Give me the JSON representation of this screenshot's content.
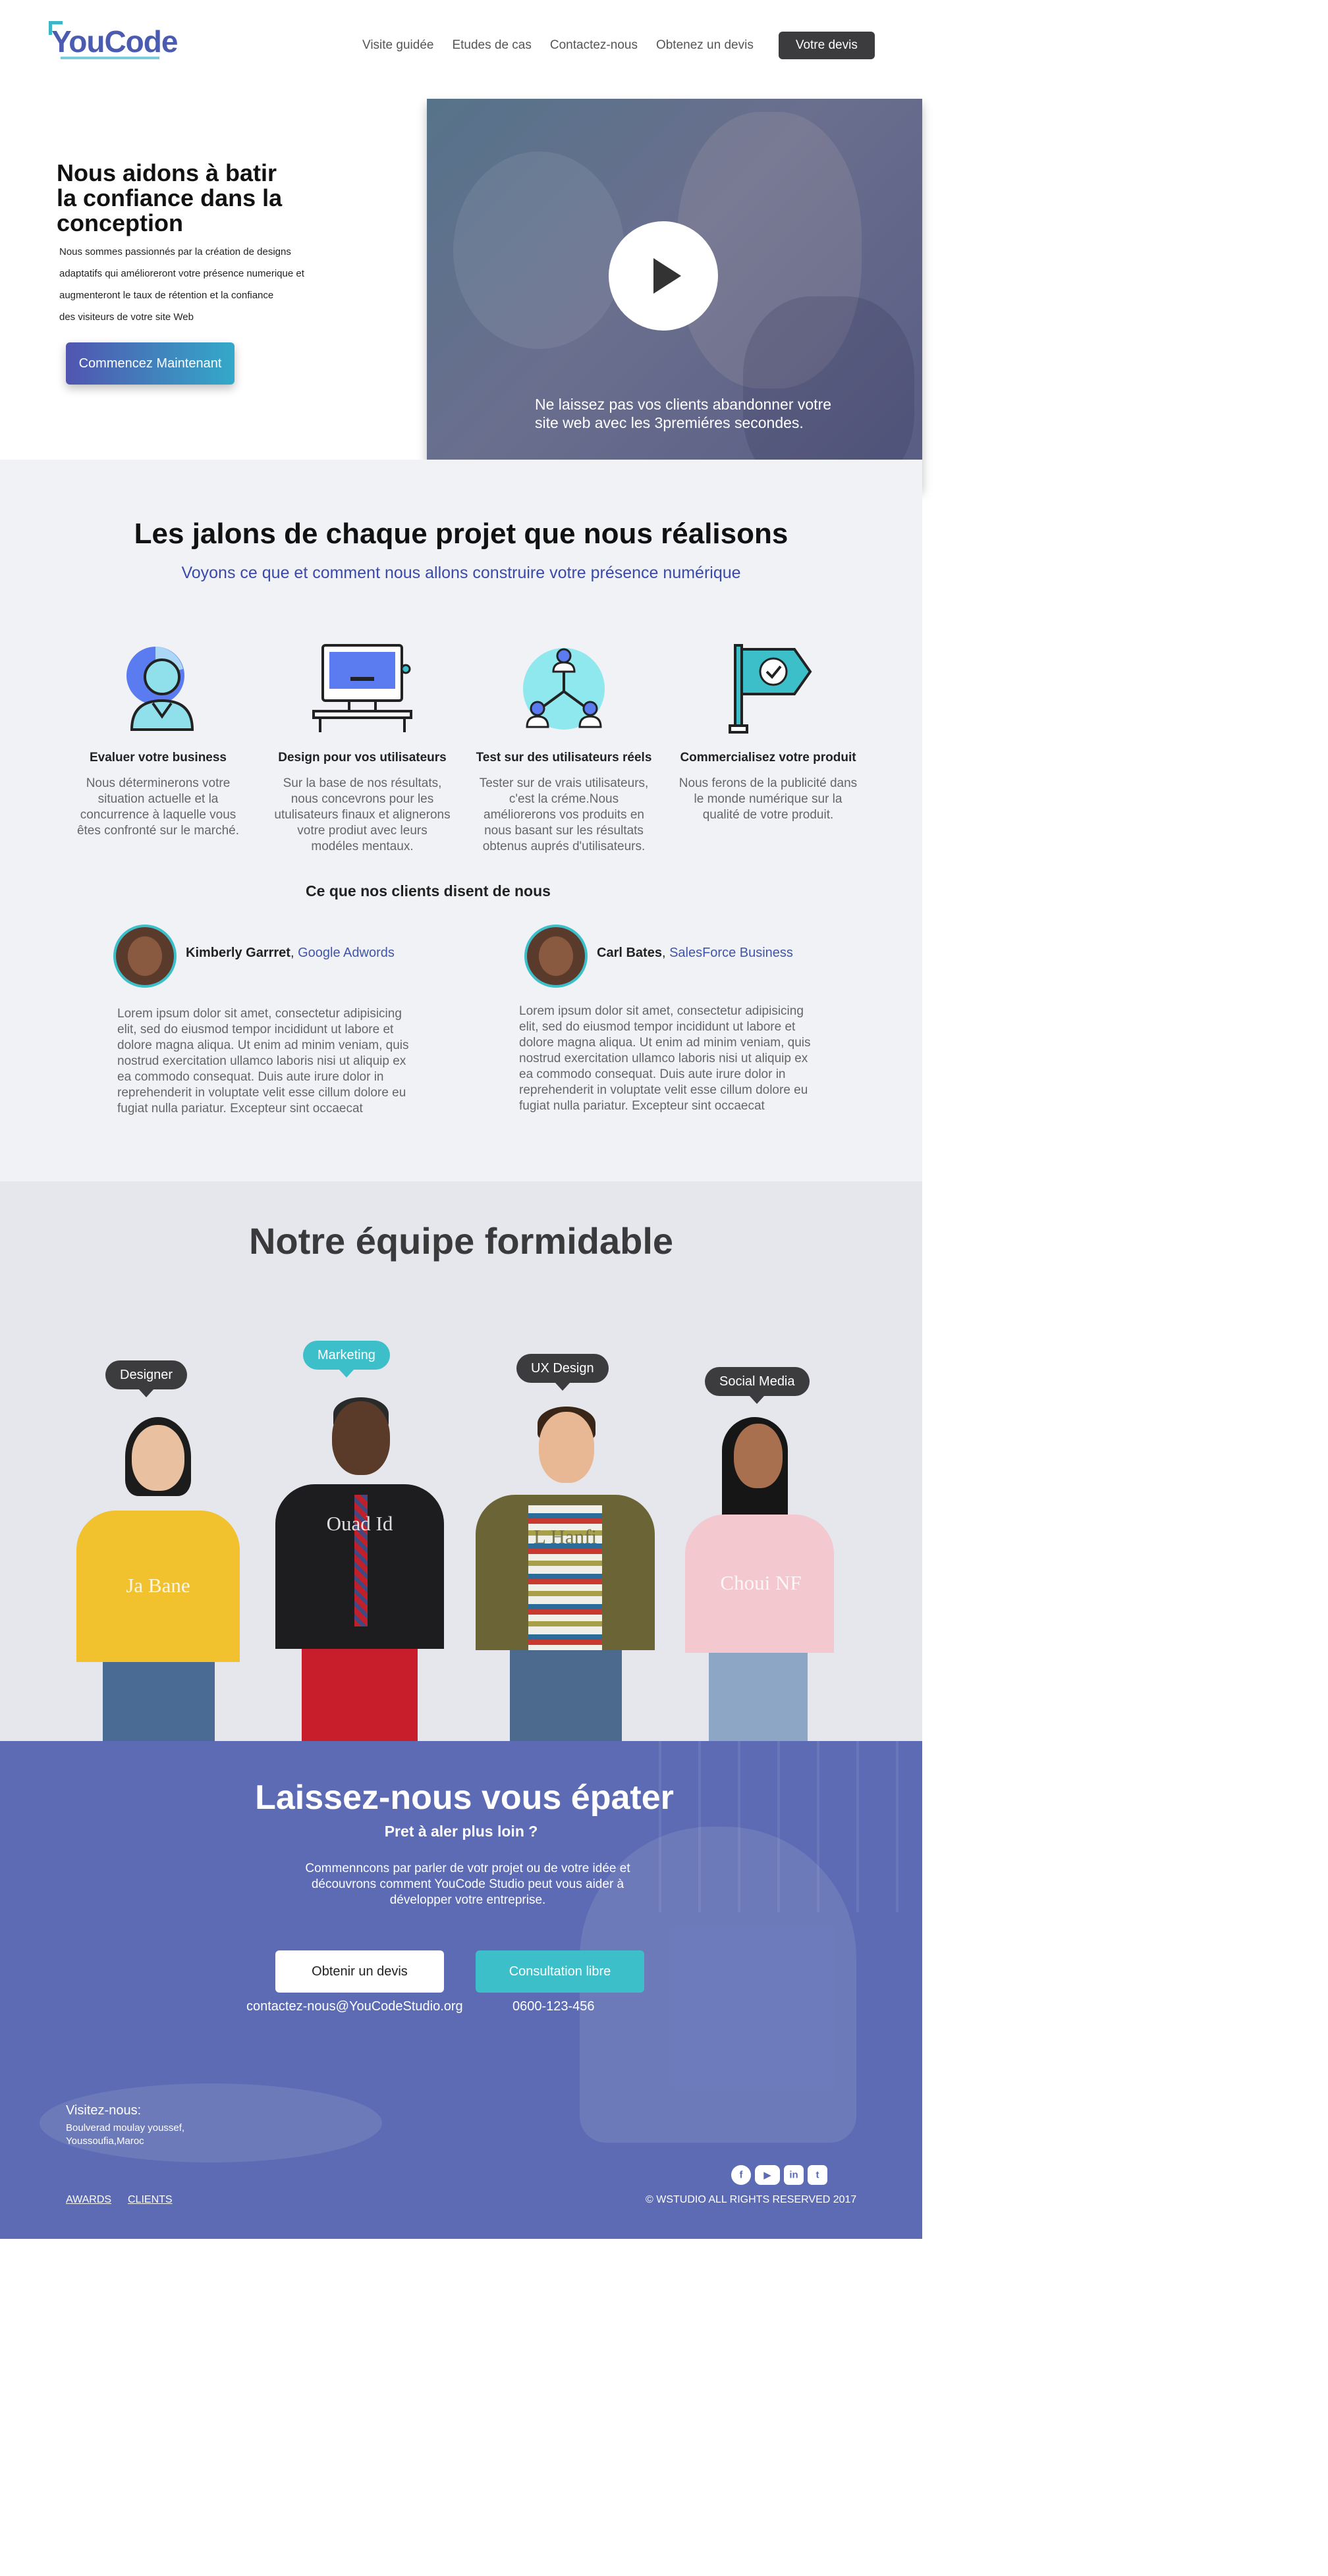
{
  "header": {
    "logo": "YouCode",
    "nav": [
      "Visite guidée",
      "Etudes de cas",
      "Contactez-nous",
      "Obtenez un devis"
    ],
    "cta": "Votre devis"
  },
  "hero": {
    "title_lines": [
      "Nous aidons à batir",
      "la confiance dans la",
      "conception"
    ],
    "desc_lines": [
      "Nous sommes passionnés par la création de designs",
      "adaptatifs qui amélioreront votre présence numerique et",
      "augmenteront le taux de rétention et la confiance",
      "des visiteurs de votre site Web"
    ],
    "button": "Commencez Maintenant",
    "video_caption_lines": [
      "Ne laissez pas vos clients abandonner votre",
      "site web avec les 3premiéres secondes."
    ]
  },
  "milestones": {
    "title": "Les jalons de chaque projet que nous réalisons",
    "subtitle": "Voyons ce que et comment nous allons construire votre présence numérique",
    "cards": [
      {
        "icon": "user-chart-icon",
        "title": "Evaluer votre business",
        "lines": [
          "Nous déterminerons votre",
          "situation actuelle et la",
          "concurrence à laquelle vous",
          "êtes confronté sur le marché."
        ]
      },
      {
        "icon": "desk-computer-icon",
        "title": "Design pour  vos utilisateurs",
        "lines": [
          "Sur la base de nos résultats,",
          "nous concevrons pour les",
          "utulisateurs finaux et alignerons",
          "votre prodiut avec leurs",
          "modéles mentaux."
        ]
      },
      {
        "icon": "user-network-icon",
        "title": "Test sur des utilisateurs réels",
        "lines": [
          "Tester sur de vrais utilisateurs,",
          "c'est la créme.Nous",
          "améliorerons vos produits en",
          "nous basant sur les résultats",
          "obtenus auprés d'utilisateurs."
        ]
      },
      {
        "icon": "flag-check-icon",
        "title": "Commercialisez votre produit",
        "lines": [
          "Nous ferons de la publicité dans",
          "le monde numérique sur la",
          "qualité de votre produit."
        ]
      }
    ]
  },
  "testimonials": {
    "title": "Ce que nos clients disent de nous",
    "items": [
      {
        "name": "Kimberly Garrret",
        "company": "Google Adwords",
        "lines": [
          "Lorem ipsum dolor sit amet, consectetur adipisicing",
          "elit, sed do eiusmod tempor incididunt ut labore et",
          "dolore magna aliqua. Ut enim ad minim veniam, quis",
          "nostrud exercitation ullamco laboris nisi ut aliquip ex",
          "ea commodo consequat. Duis aute irure dolor in",
          "reprehenderit in voluptate velit esse cillum dolore eu",
          "fugiat nulla pariatur. Excepteur sint occaecat"
        ]
      },
      {
        "name": "Carl Bates",
        "company": "SalesForce Business",
        "lines": [
          "Lorem ipsum dolor sit amet, consectetur adipisicing",
          "elit, sed do eiusmod tempor incididunt ut labore et",
          "dolore magna aliqua. Ut enim ad minim veniam, quis",
          "nostrud exercitation ullamco laboris nisi ut aliquip ex",
          "ea commodo consequat. Duis aute irure dolor in",
          "reprehenderit in voluptate velit esse cillum dolore eu",
          "fugiat nulla pariatur. Excepteur sint occaecat"
        ]
      }
    ]
  },
  "team": {
    "title": "Notre équipe formidable",
    "members": [
      {
        "role": "Designer",
        "name": "Ja Bane",
        "active": false
      },
      {
        "role": "Marketing",
        "name": "Ouad Id",
        "active": true
      },
      {
        "role": "UX Design",
        "name": "L Hanfi",
        "active": false
      },
      {
        "role": "Social Media",
        "name": "Choui NF",
        "active": false
      }
    ]
  },
  "cta": {
    "title": "Laissez-nous vous épater",
    "subtitle": "Pret à aler plus loin ?",
    "desc_lines": [
      "Commenncons par parler de votr projet ou de votre idée et",
      "découvrons comment YouCode Studio peut vous aider à",
      "développer votre entreprise."
    ],
    "button_quote": "Obtenir un devis",
    "button_consult": "Consultation libre",
    "email": "contactez-nous@YouCodeStudio.org",
    "phone": "0600-123-456"
  },
  "footer": {
    "visit_label": "Visitez-nous:",
    "address_lines": [
      "Boulverad moulay youssef,",
      "Youssoufia,Maroc"
    ],
    "socials": [
      "facebook-icon",
      "youtube-icon",
      "linkedin-icon",
      "twitter-icon"
    ],
    "links": [
      "AWARDS",
      "CLIENTS"
    ],
    "copyright": "© WSTUDIO ALL RIGHTS RESERVED 2017"
  },
  "colors": {
    "accent": "#3dbfca",
    "brand": "#4a5bb0",
    "dark": "#3c3c3e",
    "cta_bg": "#5c6bb3"
  }
}
